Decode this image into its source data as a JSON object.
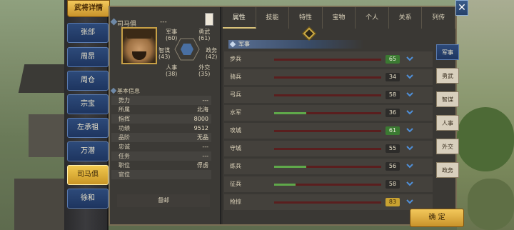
{
  "window": {
    "title": "武将详情"
  },
  "general_list": [
    "张郃",
    "周昂",
    "周仓",
    "宗宝",
    "左承祖",
    "万潜",
    "司马俱",
    "徐和"
  ],
  "selected_general": "司马俱",
  "character": {
    "name": "司马俱",
    "name_suffix": "---",
    "stats": {
      "military": {
        "label": "军事",
        "value": "(60)"
      },
      "courage": {
        "label": "勇武",
        "value": "(61)"
      },
      "strategy": {
        "label": "智谋",
        "value": "(43)"
      },
      "politics": {
        "label": "政务",
        "value": "(42)"
      },
      "personnel": {
        "label": "人事",
        "value": "(38)"
      },
      "diplomacy": {
        "label": "外交",
        "value": "(35)"
      }
    }
  },
  "basic_info": {
    "title": "基本信息",
    "rows": [
      {
        "k": "势力",
        "v": "---"
      },
      {
        "k": "所属",
        "v": "北海"
      },
      {
        "k": "指挥",
        "v": "8000"
      },
      {
        "k": "功绩",
        "v": "9512"
      },
      {
        "k": "品阶",
        "v": "无品"
      },
      {
        "k": "忠诚",
        "v": "---"
      },
      {
        "k": "任务",
        "v": "---"
      },
      {
        "k": "职位",
        "v": "俘虏"
      },
      {
        "k": "官位",
        "v": ""
      }
    ],
    "footer": "督邮"
  },
  "tabs": [
    "属性",
    "技能",
    "特性",
    "宝物",
    "个人",
    "关系",
    "列传"
  ],
  "active_tab": "属性",
  "military_section": {
    "title": "军事",
    "rows": [
      {
        "name": "步兵",
        "value": "65",
        "level": 0.0,
        "tone": "green"
      },
      {
        "name": "骑兵",
        "value": "34",
        "level": 0.0,
        "tone": ""
      },
      {
        "name": "弓兵",
        "value": "58",
        "level": 0.0,
        "tone": ""
      },
      {
        "name": "水军",
        "value": "36",
        "level": 0.3,
        "tone": ""
      },
      {
        "name": "攻城",
        "value": "61",
        "level": 0.0,
        "tone": "green"
      },
      {
        "name": "守城",
        "value": "55",
        "level": 0.0,
        "tone": ""
      },
      {
        "name": "练兵",
        "value": "56",
        "level": 0.3,
        "tone": ""
      },
      {
        "name": "征兵",
        "value": "58",
        "level": 0.2,
        "tone": ""
      },
      {
        "name": "抢掠",
        "value": "83",
        "level": 0.0,
        "tone": "gold"
      }
    ]
  },
  "side_tabs": [
    "军事",
    "勇武",
    "智谋",
    "人事",
    "外交",
    "政务"
  ],
  "active_side_tab": "军事",
  "confirm_label": "确 定",
  "close_label": "✕",
  "colors": {
    "accent_gold": "#f3c85b",
    "accent_blue": "#2d4a7a",
    "bar_green": "#5fa84a",
    "bar_red": "#5a1e1e"
  }
}
